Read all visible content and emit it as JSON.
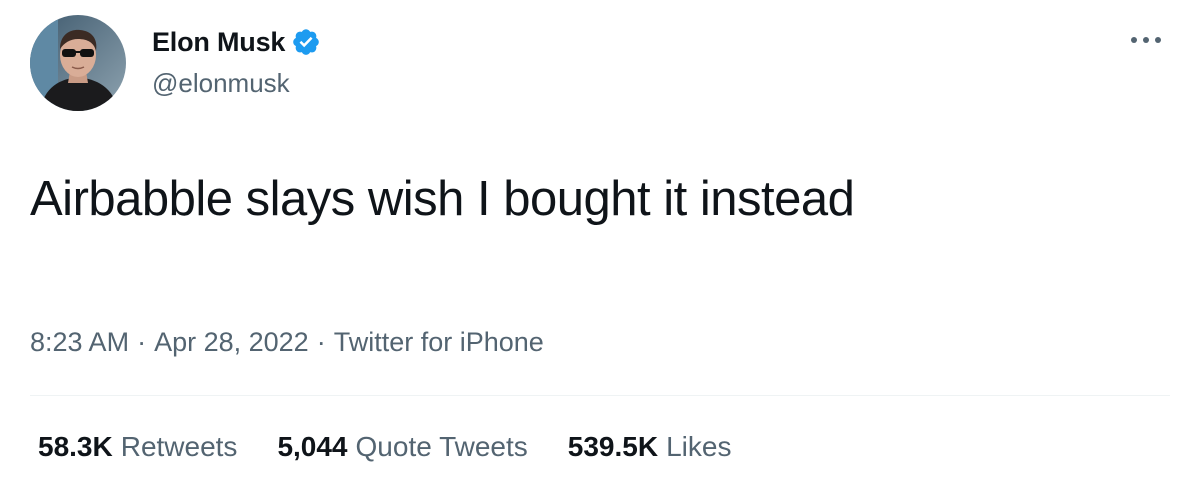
{
  "author": {
    "display_name": "Elon Musk",
    "handle": "@elonmusk",
    "verified": true,
    "verified_color": "#1d9bf0"
  },
  "tweet": {
    "text": "Airbabble slays wish I bought it instead",
    "time": "8:23 AM",
    "date": "Apr 28, 2022",
    "source": "Twitter for iPhone",
    "separator": "·"
  },
  "stats": {
    "retweets": {
      "count": "58.3K",
      "label": "Retweets"
    },
    "quote_tweets": {
      "count": "5,044",
      "label": "Quote Tweets"
    },
    "likes": {
      "count": "539.5K",
      "label": "Likes"
    }
  },
  "icons": {
    "more": "more-horizontal-icon",
    "verified": "verified-badge-icon"
  },
  "colors": {
    "text_primary": "#0f1419",
    "text_secondary": "#536471",
    "divider": "#eff3f4"
  }
}
